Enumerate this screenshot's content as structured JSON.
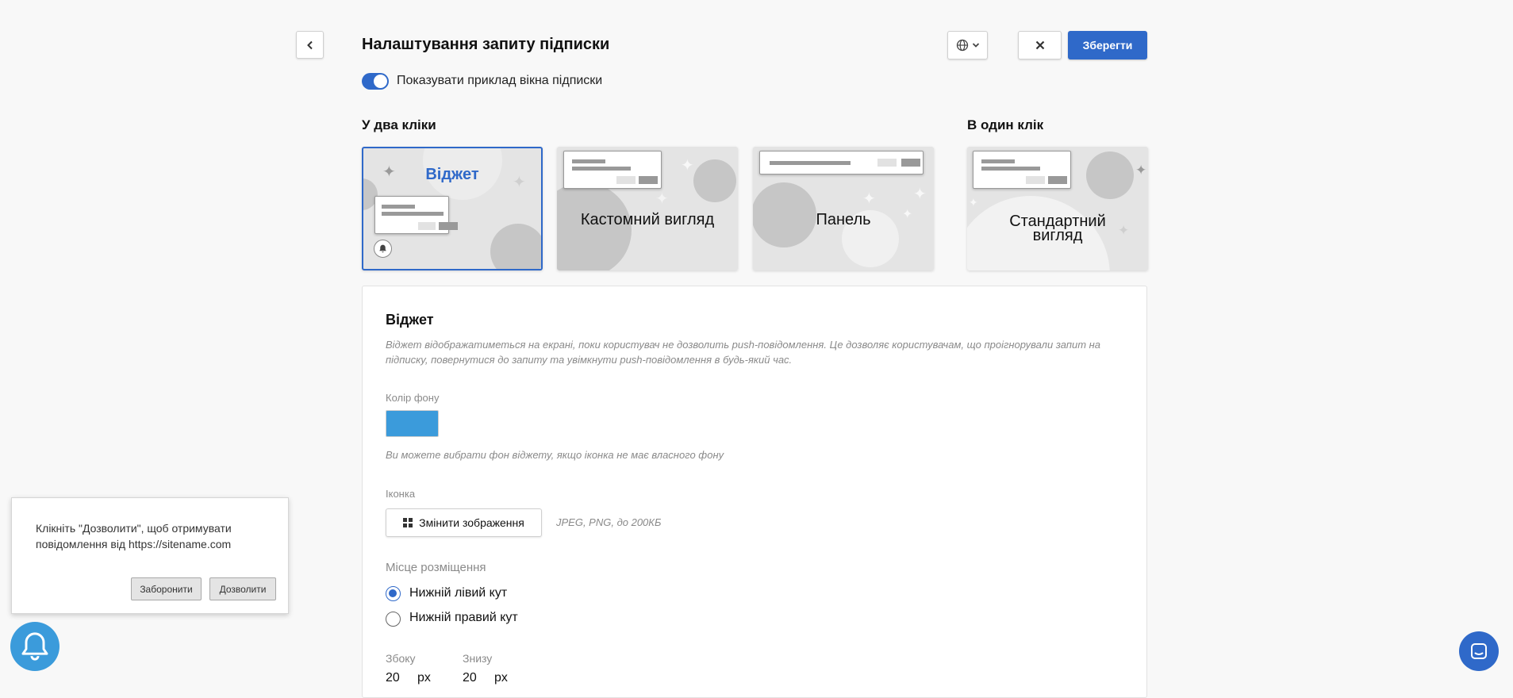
{
  "header": {
    "title": "Налаштування запиту підписки",
    "save_label": "Зберегти"
  },
  "toggle": {
    "label": "Показувати приклад вікна підписки",
    "on": true
  },
  "sections": {
    "two_click": "У два кліки",
    "one_click": "В один клік"
  },
  "cards": [
    {
      "label": "Віджет",
      "selected": true
    },
    {
      "label": "Кастомний вигляд",
      "selected": false
    },
    {
      "label": "Панель",
      "selected": false
    },
    {
      "label": "Стандартний вигляд",
      "selected": false
    }
  ],
  "panel": {
    "title": "Віджет",
    "description": "Віджет відображатиметься на екрані, поки користувач не дозволить push-повідомлення. Це дозволяє користувачам, що проігнорували запит на підписку, повернутися до запиту та увімкнути push-повідомлення в будь-який час.",
    "bg_color_label": "Колір фону",
    "bg_color": "#3b9bdb",
    "bg_color_hint": "Ви можете вибрати фон віджету, якщо іконка не має власного фону",
    "icon_label": "Іконка",
    "change_image_label": "Змінити зображення",
    "image_hint": "JPEG, PNG, до 200КБ",
    "placement_label": "Місце розміщення",
    "placement_options": [
      {
        "label": "Нижній лівий кут",
        "checked": true
      },
      {
        "label": "Нижній правий кут",
        "checked": false
      }
    ],
    "offset_side_label": "Збоку",
    "offset_side_value": "20",
    "offset_bottom_label": "Знизу",
    "offset_bottom_value": "20",
    "unit": "px"
  },
  "popup_preview": {
    "text": "Клікніть \"Дозволити\", щоб отримувати повідомлення від https://sitename.com",
    "deny_label": "Заборонити",
    "allow_label": "Дозволити"
  },
  "colors": {
    "accent": "#2f69c9",
    "widget_blue": "#3b9bdb",
    "page_bg": "#f8f8f8"
  },
  "icons": {
    "back": "chevron-left-icon",
    "language": "globe-icon",
    "close": "close-icon",
    "widget_bell": "bell-icon",
    "chat": "chat-icon"
  }
}
